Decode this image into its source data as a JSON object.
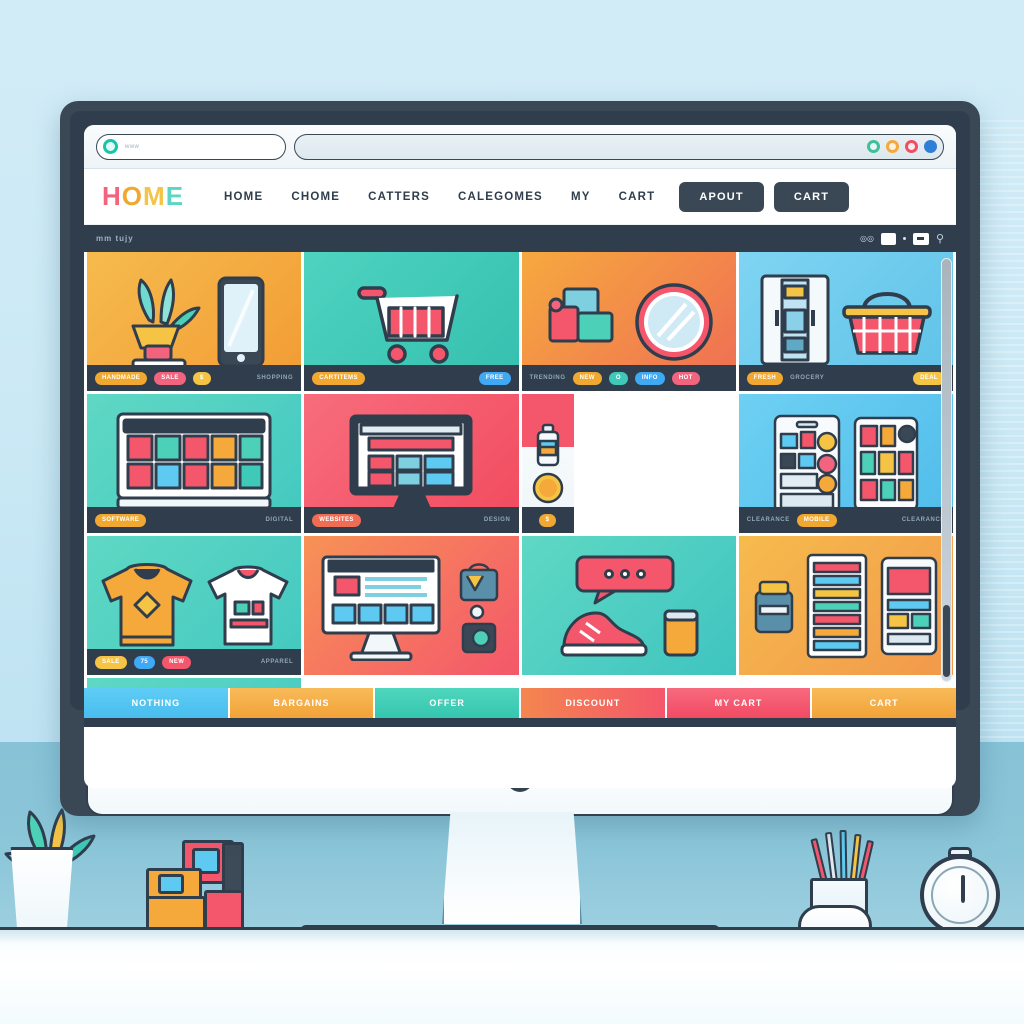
{
  "scene": {
    "description": "Illustration of desktop monitor showing an e-commerce website",
    "background_color": "#cdeaf5",
    "desk_color": "#ffffff",
    "bezel_color": "#3a4856"
  },
  "browser": {
    "url_placeholder": "www",
    "url_icon": "circle-icon",
    "window_dots": [
      {
        "name": "minimize-dot",
        "color": "#3fbf9e"
      },
      {
        "name": "maximize-dot",
        "color": "#f4a93a"
      },
      {
        "name": "close-dot",
        "color": "#f04f63"
      },
      {
        "name": "extension-dot",
        "color": "#2f7fd6"
      }
    ]
  },
  "site": {
    "logo": {
      "chars": [
        "H",
        "O",
        "M",
        "E"
      ],
      "text": "HOME"
    },
    "nav_links": [
      "HOME",
      "CHOME",
      "CATTERS",
      "CALEGOMES",
      "MY",
      "CART"
    ],
    "nav_buttons": [
      "APOUT",
      "CART"
    ]
  },
  "subbar": {
    "left_label": "mm tujy",
    "icons": [
      "camera-icon",
      "grid-view-icon",
      "dot-icon",
      "list-view-icon",
      "search-icon"
    ]
  },
  "grid": {
    "tiles": [
      {
        "name": "home-decor-tile",
        "bg": "#f4a93a",
        "art": "plant-and-phone",
        "pills": [
          {
            "label": "HANDMADE",
            "color": "#f0a830"
          },
          {
            "label": "SALE",
            "color": "#f2647e"
          },
          {
            "label": "$",
            "color": "#f6c445"
          }
        ],
        "meta": "SHOPPING"
      },
      {
        "name": "shopping-cart-tile",
        "bg": "#3fc9b8",
        "art": "shopping-cart",
        "pills": [
          {
            "label": "CARTITEMS",
            "color": "#f0a830"
          },
          {
            "label": "FREE",
            "color": "#3fa9f5"
          }
        ],
        "meta": ""
      },
      {
        "name": "media-mirror-tile",
        "bg": "#ef6d54",
        "art": "cards-and-mirror",
        "pills": [
          {
            "label": "NEW",
            "color": "#f0a830"
          },
          {
            "label": "O",
            "color": "#3fc9b8"
          },
          {
            "label": "INFO",
            "color": "#3fa9f5"
          },
          {
            "label": "HOT",
            "color": "#f2647e"
          }
        ],
        "meta": "TRENDING"
      },
      {
        "name": "fridge-basket-tile",
        "bg": "#6fc9ec",
        "art": "fridge-and-basket",
        "pills": [
          {
            "label": "FRESH",
            "color": "#f0a830"
          },
          {
            "label": "DEAL",
            "color": "#f6c445"
          }
        ],
        "meta": "GROCERY"
      },
      {
        "name": "desktop-apps-tile",
        "bg": "#4dd0b8",
        "art": "monitor-app-grid",
        "pills": [
          {
            "label": "SOFTWARE",
            "color": "#f0a830"
          }
        ],
        "meta": "DIGITAL"
      },
      {
        "name": "website-preview-tile",
        "bg": "#f4576b",
        "art": "monitor-website",
        "pills": [
          {
            "label": "WEBSITES",
            "color": "#ef6d54"
          }
        ],
        "meta": "DESIGN"
      },
      {
        "name": "bottle-coin-tile",
        "bg": "#f2f6f9",
        "art": "bottle-and-coin",
        "pills": [
          {
            "label": "$",
            "color": "#f0a830"
          }
        ],
        "meta": ""
      },
      {
        "name": "tablets-apps-tile",
        "bg": "#5ecaf2",
        "art": "two-tablets",
        "pills": [
          {
            "label": "MOBILE",
            "color": "#f0a830"
          }
        ],
        "meta": "CLEARANCE",
        "lead": "CLEARANCE"
      },
      {
        "name": "apparel-tile",
        "bg": "#4dd0b8",
        "art": "sweater-and-tshirt",
        "pills": [
          {
            "label": "SALE",
            "color": "#f6c445"
          },
          {
            "label": "75",
            "color": "#3fa9f5"
          },
          {
            "label": "NEW",
            "color": "#f4576b"
          }
        ],
        "meta": "APPAREL"
      },
      {
        "name": "workstation-tile",
        "bg": "#f4576b",
        "art": "monitor-and-bag",
        "pills": [],
        "meta": ""
      },
      {
        "name": "shoe-chat-tile",
        "bg": "#4dd0b8",
        "art": "sneaker-and-chat",
        "pills": [],
        "meta": ""
      },
      {
        "name": "catalog-tile",
        "bg": "#f4a93a",
        "art": "catalog-and-tablet",
        "pills": [],
        "meta": ""
      },
      {
        "name": "hoodie-basket-tile",
        "bg": "#4dd0b8",
        "art": "hoodie-and-basket",
        "pills": [],
        "meta": ""
      }
    ]
  },
  "bottom_bar": {
    "segments": [
      {
        "label": "NOTHING",
        "color": "#4fc3f0"
      },
      {
        "label": "BARGAINS",
        "color": "#f4a93a"
      },
      {
        "label": "OFFER",
        "color": "#3fc9b8"
      },
      {
        "label": "DISCOUNT",
        "color": "#ef6d54"
      },
      {
        "label": "MY CART",
        "color": "#f4576b"
      },
      {
        "label": "CART",
        "color": "#f4a93a"
      }
    ]
  },
  "scrollbar": {
    "name": "vertical-scrollbar",
    "thumb_position": "bottom"
  },
  "desk_props": [
    {
      "name": "potted-plant",
      "position": "left"
    },
    {
      "name": "stacked-boxes",
      "position": "left-center"
    },
    {
      "name": "keyboard",
      "position": "center"
    },
    {
      "name": "computer-mouse",
      "position": "right"
    },
    {
      "name": "pencil-cup",
      "position": "right"
    },
    {
      "name": "alarm-clock",
      "position": "far-right"
    }
  ]
}
